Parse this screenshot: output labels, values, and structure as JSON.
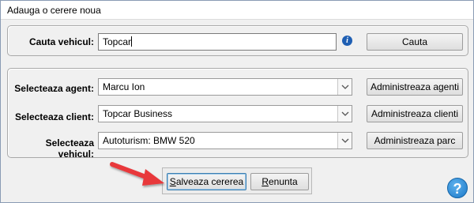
{
  "window": {
    "title": "Adauga o cerere noua"
  },
  "search": {
    "label": "Cauta vehicul:",
    "value": "Topcar",
    "button": "Cauta",
    "info_icon": "info-icon"
  },
  "agent": {
    "label": "Selecteaza agent:",
    "value": "Marcu Ion",
    "button": "Administreaza agenti"
  },
  "client": {
    "label": "Selecteaza client:",
    "value": "Topcar Business",
    "button": "Administreaza clienti"
  },
  "vehicle": {
    "label": "Selecteaza vehicul:",
    "value": "Autoturism: BMW 520",
    "button": "Administreaza parc"
  },
  "actions": {
    "save_first": "S",
    "save_rest": "alveaza cererea",
    "cancel_first": "R",
    "cancel_rest": "enunta"
  },
  "help_icon": "help-icon",
  "colors": {
    "accent": "#1f5fb3",
    "arrow": "#e8373a",
    "help": "#1b78c7"
  }
}
